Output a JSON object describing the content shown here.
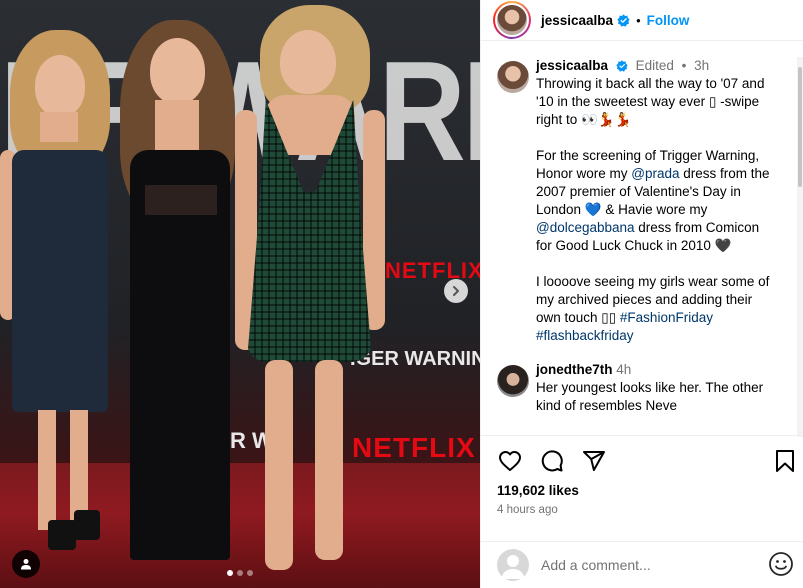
{
  "media": {
    "bg_big_text": "ER WARNING",
    "brand_text": "NETFLIX",
    "banner_text": "IGER WARNING",
    "banner_text_small": "R WAI",
    "carousel_dots": 3,
    "active_dot": 0
  },
  "header": {
    "username": "jessicaalba",
    "bullet": "•",
    "follow_label": "Follow"
  },
  "caption": {
    "username": "jessicaalba",
    "edited": "Edited",
    "dot": "•",
    "time": "3h",
    "line1": "Throwing it back all the way to '07 and '10 in the sweetest way ever",
    "box_glyph": "▯",
    "swipe": " -swipe right to 👀💃💃",
    "p2_a": "For the screening of Trigger Warning, Honor wore my ",
    "p2_mention1": "@prada",
    "p2_b": " dress from the 2007 premier of Valentine's Day in London ",
    "p2_heart_blue": "💙",
    "p2_c": " & Havie wore my ",
    "p2_mention2": "@dolcegabbana",
    "p2_d": " dress from Comicon for Good Luck Chuck in 2010 ",
    "p2_heart_black": "🖤",
    "p3_a": "I loooove seeing my girls wear some of my archived pieces and adding their own touch ",
    "p3_boxes": "▯▯",
    "p3_tag1": "#FashionFriday",
    "p3_tag2": "#flashbackfriday"
  },
  "comment": {
    "username": "jonedthe7th",
    "time": "4h",
    "text": "Her youngest looks like her. The other kind of resembles Neve"
  },
  "actions": {
    "likes": "119,602 likes",
    "time_ago": "4 hours ago"
  },
  "comment_box": {
    "placeholder": "Add a comment..."
  },
  "colors": {
    "accent": "#0095f6",
    "link": "#00376b",
    "netflix_red": "#e50914"
  },
  "icons": [
    "user-tag-icon",
    "chevron-right-icon",
    "verified-badge-icon",
    "heart-icon",
    "comment-icon",
    "share-icon",
    "bookmark-icon",
    "emoji-icon"
  ]
}
